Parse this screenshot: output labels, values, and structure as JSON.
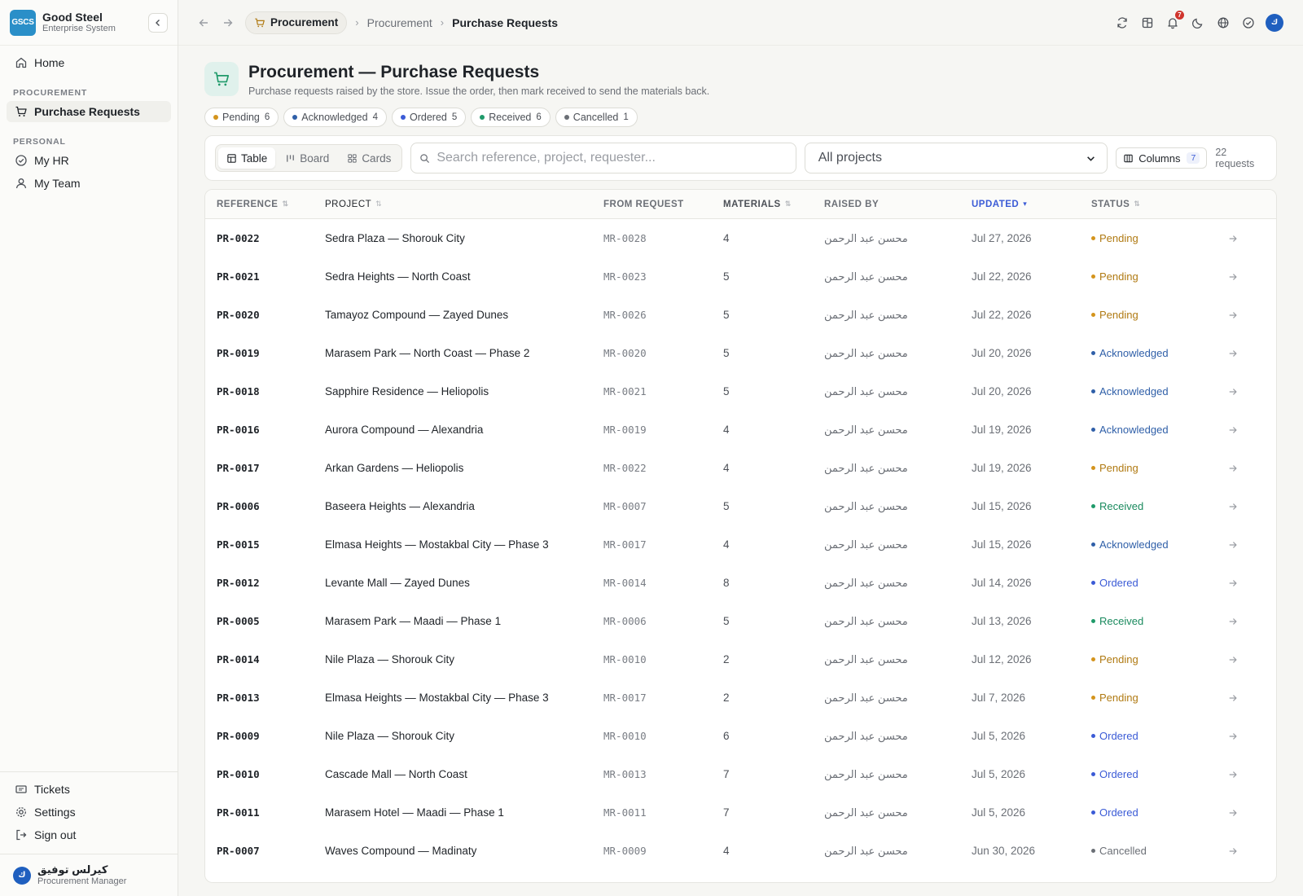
{
  "brand": {
    "logo": "GSCS",
    "name": "Good Steel",
    "subtitle": "Enterprise System"
  },
  "sidebar": {
    "home": "Home",
    "section_procurement": "PROCUREMENT",
    "purchase_requests": "Purchase Requests",
    "section_personal": "PERSONAL",
    "my_hr": "My HR",
    "my_team": "My Team",
    "tickets": "Tickets",
    "settings": "Settings",
    "sign_out": "Sign out"
  },
  "user": {
    "initials": "ك",
    "name": "كيرلس توفيق",
    "role": "Procurement Manager"
  },
  "topbar": {
    "module": "Procurement",
    "crumb_1": "Procurement",
    "crumb_2": "Purchase Requests",
    "notifications": "7",
    "avatar": "ك"
  },
  "page": {
    "title": "Procurement — Purchase Requests",
    "subtitle": "Purchase requests raised by the store. Issue the order, then mark received to send the materials back."
  },
  "status_chips": [
    {
      "label": "Pending",
      "count": "6",
      "color": "#d4941c"
    },
    {
      "label": "Acknowledged",
      "count": "4",
      "color": "#2f5fa8"
    },
    {
      "label": "Ordered",
      "count": "5",
      "color": "#3b5bd6"
    },
    {
      "label": "Received",
      "count": "6",
      "color": "#1f9a6a"
    },
    {
      "label": "Cancelled",
      "count": "1",
      "color": "#6b6f76"
    }
  ],
  "toolbar": {
    "view_table": "Table",
    "view_board": "Board",
    "view_cards": "Cards",
    "search_placeholder": "Search reference, project, requester...",
    "project_filter": "All projects",
    "columns_label": "Columns",
    "columns_count": "7",
    "requests_count": "22 requests"
  },
  "table": {
    "headers": {
      "reference": "REFERENCE",
      "project": "PROJECT",
      "from_request": "FROM REQUEST",
      "materials": "MATERIALS",
      "raised_by": "RAISED BY",
      "updated": "UPDATED",
      "status": "STATUS"
    },
    "rows": [
      {
        "ref": "PR-0022",
        "project": "Sedra Plaza — Shorouk City",
        "from": "MR-0028",
        "materials": "4",
        "by": "محسن عبد الرحمن",
        "updated": "Jul 27, 2026",
        "status": "Pending",
        "color": "#d4941c",
        "text_color": "#b07a12"
      },
      {
        "ref": "PR-0021",
        "project": "Sedra Heights — North Coast",
        "from": "MR-0023",
        "materials": "5",
        "by": "محسن عبد الرحمن",
        "updated": "Jul 22, 2026",
        "status": "Pending",
        "color": "#d4941c",
        "text_color": "#b07a12"
      },
      {
        "ref": "PR-0020",
        "project": "Tamayoz Compound — Zayed Dunes",
        "from": "MR-0026",
        "materials": "5",
        "by": "محسن عبد الرحمن",
        "updated": "Jul 22, 2026",
        "status": "Pending",
        "color": "#d4941c",
        "text_color": "#b07a12"
      },
      {
        "ref": "PR-0019",
        "project": "Marasem Park — North Coast — Phase 2",
        "from": "MR-0020",
        "materials": "5",
        "by": "محسن عبد الرحمن",
        "updated": "Jul 20, 2026",
        "status": "Acknowledged",
        "color": "#2f5fa8",
        "text_color": "#2f5fa8"
      },
      {
        "ref": "PR-0018",
        "project": "Sapphire Residence — Heliopolis",
        "from": "MR-0021",
        "materials": "5",
        "by": "محسن عبد الرحمن",
        "updated": "Jul 20, 2026",
        "status": "Acknowledged",
        "color": "#2f5fa8",
        "text_color": "#2f5fa8"
      },
      {
        "ref": "PR-0016",
        "project": "Aurora Compound — Alexandria",
        "from": "MR-0019",
        "materials": "4",
        "by": "محسن عبد الرحمن",
        "updated": "Jul 19, 2026",
        "status": "Acknowledged",
        "color": "#2f5fa8",
        "text_color": "#2f5fa8"
      },
      {
        "ref": "PR-0017",
        "project": "Arkan Gardens — Heliopolis",
        "from": "MR-0022",
        "materials": "4",
        "by": "محسن عبد الرحمن",
        "updated": "Jul 19, 2026",
        "status": "Pending",
        "color": "#d4941c",
        "text_color": "#b07a12"
      },
      {
        "ref": "PR-0006",
        "project": "Baseera Heights — Alexandria",
        "from": "MR-0007",
        "materials": "5",
        "by": "محسن عبد الرحمن",
        "updated": "Jul 15, 2026",
        "status": "Received",
        "color": "#1f9a6a",
        "text_color": "#1a8a5e"
      },
      {
        "ref": "PR-0015",
        "project": "Elmasa Heights — Mostakbal City — Phase 3",
        "from": "MR-0017",
        "materials": "4",
        "by": "محسن عبد الرحمن",
        "updated": "Jul 15, 2026",
        "status": "Acknowledged",
        "color": "#2f5fa8",
        "text_color": "#2f5fa8"
      },
      {
        "ref": "PR-0012",
        "project": "Levante Mall — Zayed Dunes",
        "from": "MR-0014",
        "materials": "8",
        "by": "محسن عبد الرحمن",
        "updated": "Jul 14, 2026",
        "status": "Ordered",
        "color": "#3b5bd6",
        "text_color": "#3b5bd6"
      },
      {
        "ref": "PR-0005",
        "project": "Marasem Park — Maadi — Phase 1",
        "from": "MR-0006",
        "materials": "5",
        "by": "محسن عبد الرحمن",
        "updated": "Jul 13, 2026",
        "status": "Received",
        "color": "#1f9a6a",
        "text_color": "#1a8a5e"
      },
      {
        "ref": "PR-0014",
        "project": "Nile Plaza — Shorouk City",
        "from": "MR-0010",
        "materials": "2",
        "by": "محسن عبد الرحمن",
        "updated": "Jul 12, 2026",
        "status": "Pending",
        "color": "#d4941c",
        "text_color": "#b07a12"
      },
      {
        "ref": "PR-0013",
        "project": "Elmasa Heights — Mostakbal City — Phase 3",
        "from": "MR-0017",
        "materials": "2",
        "by": "محسن عبد الرحمن",
        "updated": "Jul 7, 2026",
        "status": "Pending",
        "color": "#d4941c",
        "text_color": "#b07a12"
      },
      {
        "ref": "PR-0009",
        "project": "Nile Plaza — Shorouk City",
        "from": "MR-0010",
        "materials": "6",
        "by": "محسن عبد الرحمن",
        "updated": "Jul 5, 2026",
        "status": "Ordered",
        "color": "#3b5bd6",
        "text_color": "#3b5bd6"
      },
      {
        "ref": "PR-0010",
        "project": "Cascade Mall — North Coast",
        "from": "MR-0013",
        "materials": "7",
        "by": "محسن عبد الرحمن",
        "updated": "Jul 5, 2026",
        "status": "Ordered",
        "color": "#3b5bd6",
        "text_color": "#3b5bd6"
      },
      {
        "ref": "PR-0011",
        "project": "Marasem Hotel — Maadi — Phase 1",
        "from": "MR-0011",
        "materials": "7",
        "by": "محسن عبد الرحمن",
        "updated": "Jul 5, 2026",
        "status": "Ordered",
        "color": "#3b5bd6",
        "text_color": "#3b5bd6"
      },
      {
        "ref": "PR-0007",
        "project": "Waves Compound — Madinaty",
        "from": "MR-0009",
        "materials": "4",
        "by": "محسن عبد الرحمن",
        "updated": "Jun 30, 2026",
        "status": "Cancelled",
        "color": "#6b6f76",
        "text_color": "#6b6f76"
      }
    ]
  },
  "colors": {
    "accent": "#3b5bd6",
    "brand": "#2a8fc8",
    "page_icon": "#1f9a6a"
  },
  "icons": {
    "home": "home-icon",
    "cart": "cart-icon",
    "hr": "check-circle-icon",
    "team": "user-icon",
    "tickets": "ticket-icon",
    "settings": "gear-icon",
    "signout": "sign-out-icon",
    "refresh": "refresh-icon",
    "grid": "grid-icon",
    "bell": "bell-icon",
    "moon": "moon-icon",
    "globe": "globe-icon",
    "check": "check-circle-icon"
  }
}
